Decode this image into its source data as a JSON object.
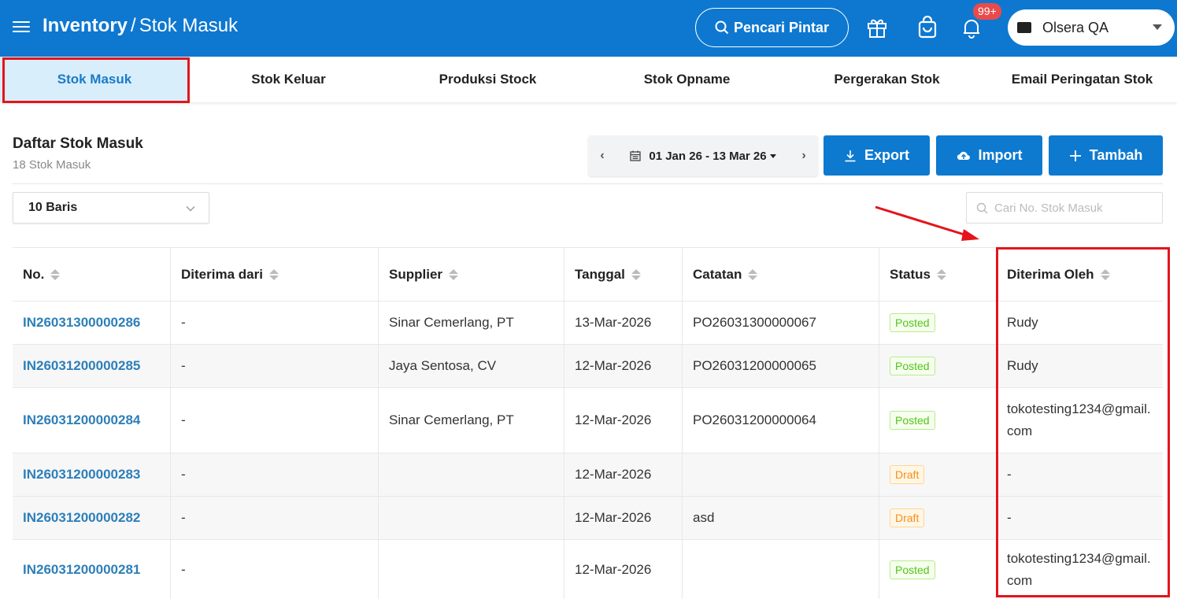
{
  "header": {
    "section": "Inventory",
    "separator": "/",
    "page": "Stok Masuk",
    "smart_search_label": "Pencari Pintar",
    "notification_count": "99+",
    "store_name": "Olsera QA"
  },
  "tabs": [
    {
      "label": "Stok Masuk",
      "active": true
    },
    {
      "label": "Stok Keluar",
      "active": false
    },
    {
      "label": "Produksi Stock",
      "active": false
    },
    {
      "label": "Stok Opname",
      "active": false
    },
    {
      "label": "Pergerakan Stok",
      "active": false
    },
    {
      "label": "Email Peringatan Stok",
      "active": false
    }
  ],
  "list": {
    "title": "Daftar Stok Masuk",
    "count_label": "18 Stok Masuk",
    "date_range": "01 Jan 26 - 13 Mar 26",
    "export_label": "Export",
    "import_label": "Import",
    "add_label": "Tambah",
    "rows_per_page": "10 Baris",
    "search_placeholder": "Cari No. Stok Masuk"
  },
  "table": {
    "columns": [
      "No.",
      "Diterima dari",
      "Supplier",
      "Tanggal",
      "Catatan",
      "Status",
      "Diterima Oleh"
    ],
    "rows": [
      [
        "IN26031300000286",
        "-",
        "Sinar Cemerlang, PT",
        "13-Mar-2026",
        "PO26031300000067",
        "Posted",
        "Rudy"
      ],
      [
        "IN26031200000285",
        "-",
        "Jaya Sentosa, CV",
        "12-Mar-2026",
        "PO26031200000065",
        "Posted",
        "Rudy"
      ],
      [
        "IN26031200000284",
        "-",
        "Sinar Cemerlang, PT",
        "12-Mar-2026",
        "PO26031200000064",
        "Posted",
        "tokotesting1234@gmail.com"
      ],
      [
        "IN26031200000283",
        "-",
        "",
        "12-Mar-2026",
        "",
        "Draft",
        "-"
      ],
      [
        "IN26031200000282",
        "-",
        "",
        "12-Mar-2026",
        "asd",
        "Draft",
        "-"
      ],
      [
        "IN26031200000281",
        "-",
        "",
        "12-Mar-2026",
        "",
        "Posted",
        "tokotesting1234@gmail.com"
      ]
    ]
  },
  "colors": {
    "primary": "#0e78d0",
    "button": "#0d7ad0",
    "active_tab_bg": "#d9eefb",
    "link": "#2d7fb8",
    "highlight": "#e4141b",
    "posted": "#52c41a",
    "draft": "#fa8c16"
  },
  "icons": {
    "menu": "hamburger-icon",
    "search": "search-icon",
    "gift": "gift-icon",
    "bag": "shopping-bag-icon",
    "bell": "bell-icon",
    "calendar": "calendar-icon",
    "download": "download-icon",
    "upload": "cloud-upload-icon",
    "plus": "plus-icon"
  }
}
